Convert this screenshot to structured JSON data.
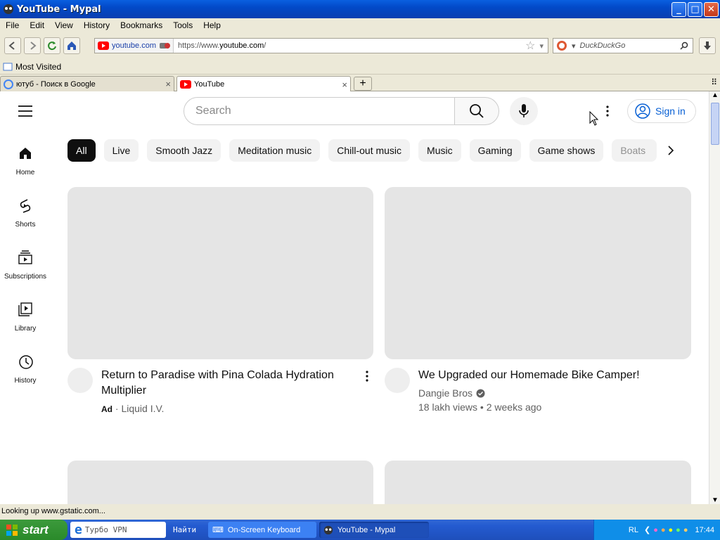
{
  "window": {
    "title": "YouTube - Mypal",
    "buttons": {
      "minimize": "_",
      "maximize": "□",
      "close": "✕"
    }
  },
  "menu": [
    "File",
    "Edit",
    "View",
    "History",
    "Bookmarks",
    "Tools",
    "Help"
  ],
  "nav": {
    "identity": "youtube.com",
    "url_prefix": "https://www.",
    "url_domain": "youtube.com",
    "url_suffix": "/",
    "search_engine_placeholder": "DuckDuckGo"
  },
  "bookmarks": {
    "most_visited": "Most Visited"
  },
  "tabs": [
    {
      "label": "ютуб - Поиск в Google"
    },
    {
      "label": "YouTube"
    }
  ],
  "youtube": {
    "search_placeholder": "Search",
    "sign_in": "Sign in",
    "chips": [
      "All",
      "Live",
      "Smooth Jazz",
      "Meditation music",
      "Chill-out music",
      "Music",
      "Gaming",
      "Game shows",
      "Boats"
    ],
    "sidebar": [
      {
        "label": "Home"
      },
      {
        "label": "Shorts"
      },
      {
        "label": "Subscriptions"
      },
      {
        "label": "Library"
      },
      {
        "label": "History"
      }
    ],
    "videos": [
      {
        "title": "Return to Paradise with Pina Colada Hydration Multiplier",
        "badge": "Ad",
        "channel": "Liquid I.V."
      },
      {
        "title": "We Upgraded our Homemade Bike Camper!",
        "channel": "Dangie Bros",
        "views": "18 lakh views",
        "age": "2 weeks ago"
      }
    ]
  },
  "status": "Looking up www.gstatic.com...",
  "taskbar": {
    "start": "start",
    "items": [
      "Турбо VPN",
      "Найти",
      "On-Screen Keyboard",
      "YouTube - Mypal"
    ],
    "lang": "RL",
    "clock": "17:44"
  },
  "colors": {
    "accent": "#065fd4",
    "chip_selected": "#0f0f0f"
  }
}
